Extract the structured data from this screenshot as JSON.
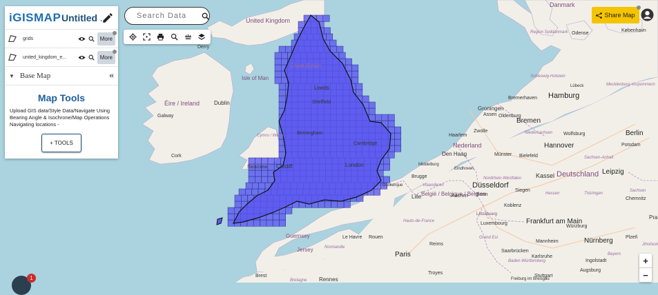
{
  "app": {
    "logo_text": "GISMAP",
    "logo_i": "i",
    "map_title": "Untitled ...",
    "pencil_icon": "pencil-icon"
  },
  "layers": [
    {
      "name": "grids",
      "more_label": "More"
    },
    {
      "name": "united_kingdom_e...",
      "more_label": "More"
    }
  ],
  "basemap": {
    "label": "Base Map",
    "collapse": "«"
  },
  "tools": {
    "heading": "Map Tools",
    "description": "Upload GIS data/Style Data/Navigate Using Bearing Angle & Isochrone/Map Operations Navigating locations -",
    "button": "+ TOOLS"
  },
  "search": {
    "placeholder": "Search Data"
  },
  "toolbar_icons": [
    "locate-icon",
    "fullscreen-icon",
    "print-icon",
    "search-icon",
    "measure-icon",
    "layers-icon"
  ],
  "share": {
    "label": "Share Map"
  },
  "zoom": {
    "in": "+",
    "out": "−"
  },
  "chat": {
    "badge": "1"
  },
  "map_labels": [
    {
      "text": "United Kingdom",
      "cls": "country"
    },
    {
      "text": "Great Britain",
      "cls": "region"
    },
    {
      "text": "Isle of Man",
      "cls": "country"
    },
    {
      "text": "Éire / Ireland",
      "cls": "country"
    },
    {
      "text": "Dublin",
      "cls": "city"
    },
    {
      "text": "Galway",
      "cls": "city"
    },
    {
      "text": "Cork",
      "cls": "city"
    },
    {
      "text": "Derry",
      "cls": "city"
    },
    {
      "text": "Cymru / Wales",
      "cls": "region"
    },
    {
      "text": "Swansea",
      "cls": "city"
    },
    {
      "text": "Cardiff",
      "cls": "city"
    },
    {
      "text": "Leeds",
      "cls": "city"
    },
    {
      "text": "Sheffield",
      "cls": "city"
    },
    {
      "text": "Birmingham",
      "cls": "city"
    },
    {
      "text": "Cambridge",
      "cls": "city"
    },
    {
      "text": "London",
      "cls": "city"
    },
    {
      "text": "Guernsey",
      "cls": "country"
    },
    {
      "text": "Jersey",
      "cls": "country"
    },
    {
      "text": "Brest",
      "cls": "city"
    },
    {
      "text": "Rennes",
      "cls": "city"
    },
    {
      "text": "Bretagne",
      "cls": "region"
    },
    {
      "text": "Le Havre",
      "cls": "city"
    },
    {
      "text": "Rouen",
      "cls": "city"
    },
    {
      "text": "Normandie",
      "cls": "region"
    },
    {
      "text": "Paris",
      "cls": "city-big"
    },
    {
      "text": "Reims",
      "cls": "city"
    },
    {
      "text": "Troyes",
      "cls": "city"
    },
    {
      "text": "Hauts-de-France",
      "cls": "region"
    },
    {
      "text": "Lille",
      "cls": "city"
    },
    {
      "text": "Dunkerque",
      "cls": "city"
    },
    {
      "text": "Brugge",
      "cls": "city"
    },
    {
      "text": "Vlaanderen",
      "cls": "region"
    },
    {
      "text": "België / Belgique / Belgien",
      "cls": "country"
    },
    {
      "text": "Den Haag",
      "cls": "city"
    },
    {
      "text": "Nederland",
      "cls": "country"
    },
    {
      "text": "Haarlem",
      "cls": "city"
    },
    {
      "text": "Zwolle",
      "cls": "city"
    },
    {
      "text": "Assen",
      "cls": "city"
    },
    {
      "text": "Groningen",
      "cls": "city"
    },
    {
      "text": "Middelburg",
      "cls": "city"
    },
    {
      "text": "Eindhoven",
      "cls": "city"
    },
    {
      "text": "Aachen",
      "cls": "city"
    },
    {
      "text": "Bonn",
      "cls": "city"
    },
    {
      "text": "Düsseldorf",
      "cls": "city-big"
    },
    {
      "text": "Nordrhein-Westfalen",
      "cls": "region"
    },
    {
      "text": "Münster",
      "cls": "city"
    },
    {
      "text": "Bielefeld",
      "cls": "city"
    },
    {
      "text": "Bremerhaven",
      "cls": "city"
    },
    {
      "text": "Oldenburg",
      "cls": "city"
    },
    {
      "text": "Bremen",
      "cls": "city-big"
    },
    {
      "text": "Niedersachsen",
      "cls": "region"
    },
    {
      "text": "Hamburg",
      "cls": "city-big"
    },
    {
      "text": "Lübeck",
      "cls": "city"
    },
    {
      "text": "Schleswig-Holstein",
      "cls": "region"
    },
    {
      "text": "Mecklenburg-Vorpommern",
      "cls": "region"
    },
    {
      "text": "Wolfsburg",
      "cls": "city"
    },
    {
      "text": "Hannover",
      "cls": "city-big"
    },
    {
      "text": "Sachsen-Anhalt",
      "cls": "region"
    },
    {
      "text": "Berlin",
      "cls": "city-big"
    },
    {
      "text": "Potsdam",
      "cls": "city"
    },
    {
      "text": "Deutschland",
      "cls": "country"
    },
    {
      "text": "Leipzig",
      "cls": "city-big"
    },
    {
      "text": "Kassel",
      "cls": "city"
    },
    {
      "text": "Hessen",
      "cls": "region"
    },
    {
      "text": "Thüringen",
      "cls": "region"
    },
    {
      "text": "Sachsen",
      "cls": "region"
    },
    {
      "text": "Chemnitz",
      "cls": "city"
    },
    {
      "text": "Koblenz",
      "cls": "city"
    },
    {
      "text": "Siegen",
      "cls": "city"
    },
    {
      "text": "Frankfurt am Main",
      "cls": "city-big"
    },
    {
      "text": "Würzburg",
      "cls": "city"
    },
    {
      "text": "Mannheim",
      "cls": "city"
    },
    {
      "text": "Nürnberg",
      "cls": "city-big"
    },
    {
      "text": "Saarbrücken",
      "cls": "city"
    },
    {
      "text": "Karlsruhe",
      "cls": "city"
    },
    {
      "text": "Ingolstadt",
      "cls": "city"
    },
    {
      "text": "Augsburg",
      "cls": "city"
    },
    {
      "text": "Baden-Württemberg",
      "cls": "region"
    },
    {
      "text": "Bayern",
      "cls": "region"
    },
    {
      "text": "Stuttgart",
      "cls": "city"
    },
    {
      "text": "Luxembourg",
      "cls": "city"
    },
    {
      "text": "Lëtzebuerg",
      "cls": "country"
    },
    {
      "text": "Grand Est",
      "cls": "region"
    },
    {
      "text": "Plzeň",
      "cls": "city"
    },
    {
      "text": "Praha",
      "cls": "city"
    },
    {
      "text": "Danmark",
      "cls": "country"
    },
    {
      "text": "Region Syddanmark",
      "cls": "region"
    },
    {
      "text": "Odense",
      "cls": "city"
    },
    {
      "text": "København",
      "cls": "city"
    },
    {
      "text": "Freiburg im Breisgau",
      "cls": "city"
    },
    {
      "text": "Jihočeský",
      "cls": "region"
    }
  ]
}
